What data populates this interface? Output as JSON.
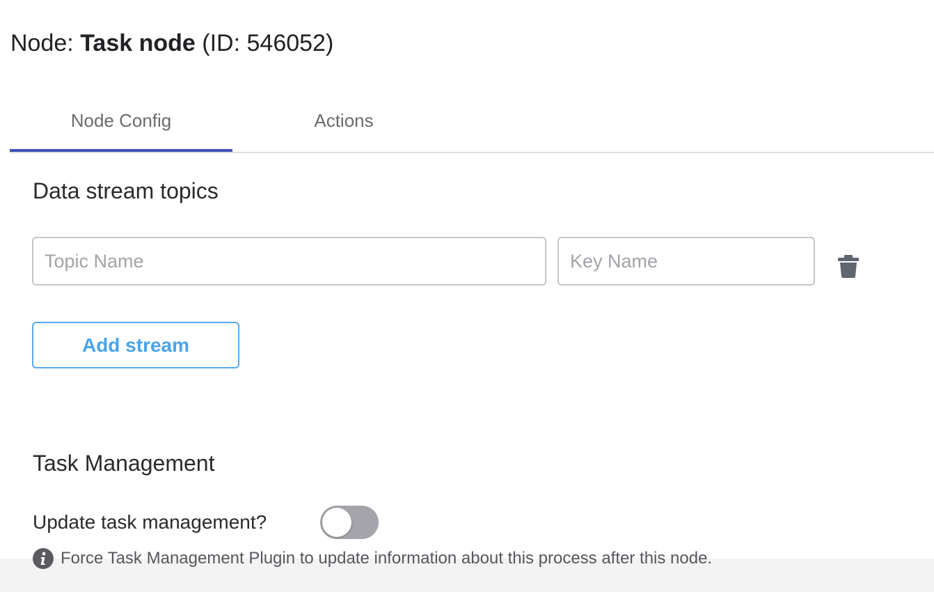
{
  "header": {
    "prefix": "Node:",
    "node_name": "Task node",
    "id_text": "(ID: 546052)"
  },
  "tabs": [
    {
      "label": "Node Config",
      "active": true
    },
    {
      "label": "Actions",
      "active": false
    }
  ],
  "data_streams": {
    "title": "Data stream topics",
    "topic_field": {
      "value": "",
      "placeholder": "Topic Name"
    },
    "key_field": {
      "value": "",
      "placeholder": "Key Name"
    },
    "delete_icon": "trash-icon",
    "add_button_label": "Add stream"
  },
  "task_management": {
    "title": "Task Management",
    "toggle_label": "Update task management?",
    "toggle_on": false,
    "info_icon": "info-icon",
    "help_text": "Force Task Management Plugin to update information about this process after this node."
  },
  "colors": {
    "accent": "#3f51b5",
    "button_blue": "#4aa3ea",
    "toggle_off": "#a4a4aa"
  }
}
